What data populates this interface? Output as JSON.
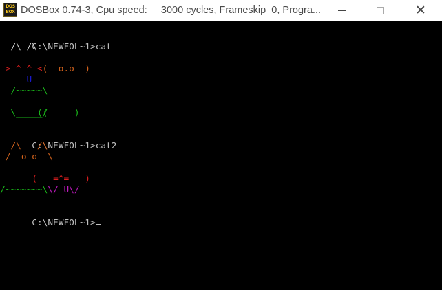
{
  "window": {
    "title": "DOSBox 0.74-3, Cpu speed:     3000 cycles, Frameskip  0, Progra...",
    "icon_label_top": "DOS",
    "icon_label_bottom": "BOX",
    "buttons": {
      "minimize_icon": "minimize-icon",
      "maximize_icon": "maximize-icon",
      "close_icon": "close-icon",
      "close_glyph": "✕"
    }
  },
  "colors": {
    "background": "#000000",
    "prompt_text": "#c0c0c0",
    "orange": "#d2621c",
    "red": "#d81e1e",
    "blue": "#1a1ad0",
    "green": "#1ab81a",
    "magenta": "#c01ac0",
    "white": "#d4d4d4"
  },
  "console": {
    "command1": {
      "prompt": "C:\\NEWFOL~1>",
      "command": "cat"
    },
    "cat1": {
      "ears": "  /\\ /\\",
      "face_left": "  ( ",
      "face_eyes": " o.o ",
      "face_right": " )",
      "whiskers": " > ^ ^ <",
      "tongue": "     U",
      "body_top": "  /~~~~~\\",
      "body_mid_left": " ((",
      "body_mid_right": "     )",
      "body_bottom": "  \\_____/"
    },
    "command2": {
      "prompt": "C:\\NEWFOL~1>",
      "command": "cat2"
    },
    "cat2": {
      "ears": "  /\\___/\\",
      "face": " /  o_o  \\",
      "nose_left": "(   ",
      "nose": "=^=",
      "nose_right": "   )",
      "paws_left": "   \\/ ",
      "paws_right": "U\\/",
      "base": "/~~~~~~~\\"
    },
    "command3": {
      "prompt": "C:\\NEWFOL~1>",
      "command": ""
    }
  }
}
